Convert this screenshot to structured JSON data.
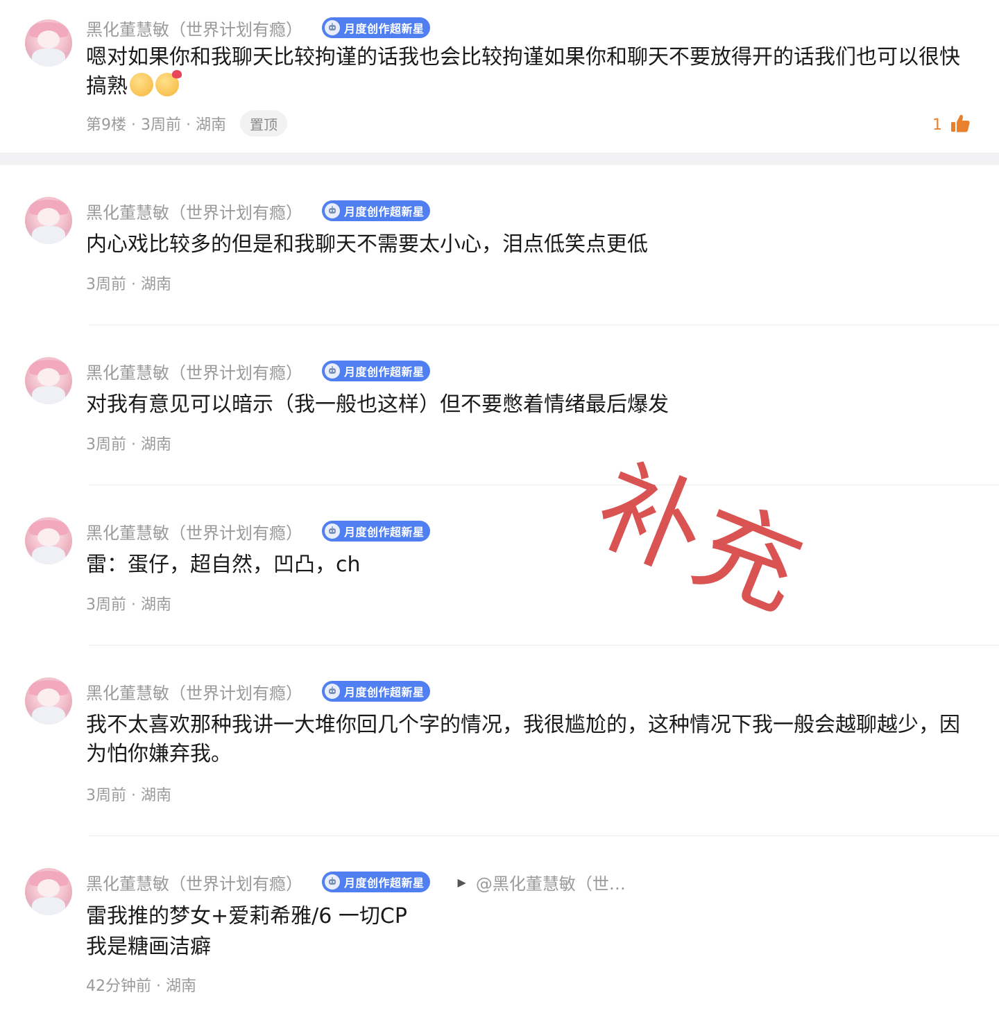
{
  "comments": [
    {
      "author": "黑化董慧敏（世界计划有瘾）",
      "badge": "月度创作超新星",
      "text": "嗯对如果你和我聊天比较拘谨的话我也会比较拘谨如果你和聊天不要放得开的话我们也可以很快搞熟",
      "meta": "第9楼 · 3周前 · 湖南",
      "pinned_label": "置顶",
      "likes": "1"
    },
    {
      "author": "黑化董慧敏（世界计划有瘾）",
      "badge": "月度创作超新星",
      "text": "内心戏比较多的但是和我聊天不需要太小心，泪点低笑点更低",
      "meta": "3周前 · 湖南"
    },
    {
      "author": "黑化董慧敏（世界计划有瘾）",
      "badge": "月度创作超新星",
      "text": "对我有意见可以暗示（我一般也这样）但不要憋着情绪最后爆发",
      "meta": "3周前 · 湖南"
    },
    {
      "author": "黑化董慧敏（世界计划有瘾）",
      "badge": "月度创作超新星",
      "text": "雷：蛋仔，超自然，凹凸，ch",
      "meta": "3周前 · 湖南"
    },
    {
      "author": "黑化董慧敏（世界计划有瘾）",
      "badge": "月度创作超新星",
      "text": "我不太喜欢那种我讲一大堆你回几个字的情况，我很尴尬的，这种情况下我一般会越聊越少，因为怕你嫌弃我。",
      "meta": "3周前 · 湖南"
    },
    {
      "author": "黑化董慧敏（世界计划有瘾）",
      "badge": "月度创作超新星",
      "reply_to": "@黑化董慧敏（世…",
      "text": "雷我推的梦女+爱莉希雅/6 一切CP\n我是糖画洁癖",
      "meta": "42分钟前 · 湖南"
    }
  ],
  "stamp_text": "补充",
  "colors": {
    "badge_bg": "#4f7ff0",
    "like_accent": "#e8802e",
    "stamp": "#d64545",
    "meta_gray": "#9a9a9a"
  },
  "icons": {
    "badge": "robot-badge-icon",
    "like": "thumbs-up-icon",
    "reply": "play-triangle-icon",
    "emoji_1": "hugging-face-emoji",
    "emoji_2": "smiling-face-with-hearts-emoji"
  }
}
